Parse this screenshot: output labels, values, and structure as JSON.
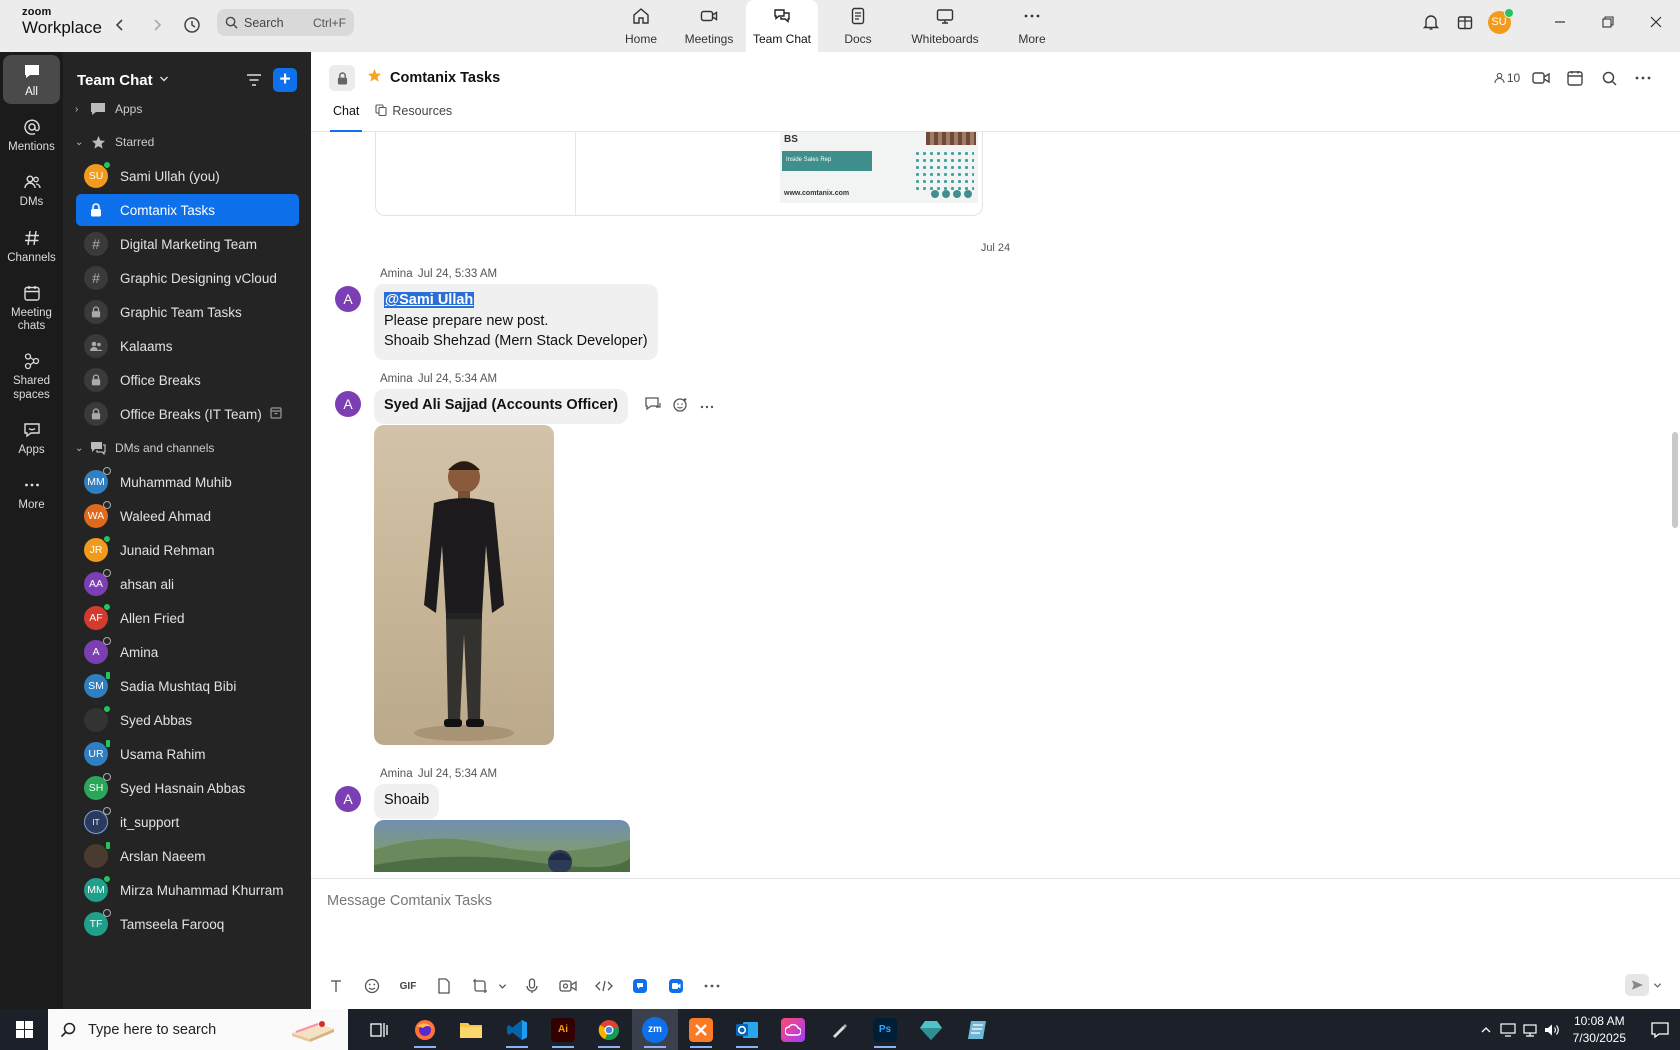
{
  "app": {
    "brand_top": "zoom",
    "brand_bottom": "Workplace"
  },
  "search": {
    "placeholder": "Search",
    "shortcut": "Ctrl+F"
  },
  "top_tabs": [
    {
      "label": "Home",
      "icon": "home-icon"
    },
    {
      "label": "Meetings",
      "icon": "video-icon"
    },
    {
      "label": "Team Chat",
      "icon": "chat-icon",
      "active": true
    },
    {
      "label": "Docs",
      "icon": "doc-icon"
    },
    {
      "label": "Whiteboards",
      "icon": "whiteboard-icon"
    },
    {
      "label": "More",
      "icon": "more-icon"
    }
  ],
  "profile": {
    "initials": "SU",
    "status_color": "#22c55e"
  },
  "rail": [
    {
      "label": "All",
      "icon": "chat-bubble-icon",
      "active": true
    },
    {
      "label": "Mentions",
      "icon": "at-icon"
    },
    {
      "label": "DMs",
      "icon": "people-icon"
    },
    {
      "label": "Channels",
      "icon": "hash-icon"
    },
    {
      "label": "Meeting chats",
      "icon": "calendar-icon"
    },
    {
      "label": "Shared spaces",
      "icon": "shared-icon"
    },
    {
      "label": "Apps",
      "icon": "apps-icon"
    },
    {
      "label": "More",
      "icon": "more-icon"
    }
  ],
  "sidebar": {
    "title": "Team Chat",
    "apps_label": "Apps",
    "starred_label": "Starred",
    "starred": [
      {
        "label": "Sami Ullah (you)",
        "kind": "avatar",
        "initials": "SU",
        "color": "#f29a1c",
        "status": "on"
      },
      {
        "label": "Comtanix Tasks",
        "kind": "lock",
        "active": true
      },
      {
        "label": "Digital Marketing Team",
        "kind": "hash"
      },
      {
        "label": "Graphic Designing vCloud",
        "kind": "hash"
      },
      {
        "label": "Graphic Team Tasks",
        "kind": "lock"
      },
      {
        "label": "Kalaams",
        "kind": "group"
      },
      {
        "label": "Office Breaks",
        "kind": "lock"
      },
      {
        "label": "Office Breaks (IT Team)",
        "kind": "lock",
        "trail": "archive-icon"
      }
    ],
    "dms_label": "DMs and channels",
    "dms": [
      {
        "label": "Muhammad Muhib",
        "initials": "MM",
        "color": "#2f7fc1",
        "status": "off"
      },
      {
        "label": "Waleed Ahmad",
        "initials": "WA",
        "color": "#e06a1c",
        "status": "off"
      },
      {
        "label": "Junaid Rehman",
        "initials": "JR",
        "color": "#f29a1c",
        "status": "on"
      },
      {
        "label": "ahsan ali",
        "initials": "AA",
        "color": "#7b3fb3",
        "status": "off"
      },
      {
        "label": "Allen Fried",
        "initials": "AF",
        "color": "#d23b2e",
        "status": "on"
      },
      {
        "label": "Amina",
        "initials": "A",
        "color": "#7b3fb3",
        "status": "off"
      },
      {
        "label": "Sadia Mushtaq Bibi",
        "initials": "SM",
        "color": "#2f7fc1",
        "status": "phone"
      },
      {
        "label": "Syed Abbas",
        "initials": "",
        "color": "#333333",
        "status": "on"
      },
      {
        "label": "Usama Rahim",
        "initials": "UR",
        "color": "#2f7fc1",
        "status": "phone"
      },
      {
        "label": "Syed Hasnain Abbas",
        "initials": "SH",
        "color": "#2aa65a",
        "status": "off"
      },
      {
        "label": "it_support",
        "initials": "IT",
        "color": "#2b3a5c",
        "status": "off"
      },
      {
        "label": "Arslan Naeem",
        "initials": "",
        "color": "#4a3a30",
        "status": "phone"
      },
      {
        "label": "Mirza Muhammad Khurram",
        "initials": "MM",
        "color": "#20a08a",
        "status": "on"
      },
      {
        "label": "Tamseela Farooq",
        "initials": "TF",
        "color": "#20a08a",
        "status": "off"
      }
    ]
  },
  "channel": {
    "name": "Comtanix Tasks",
    "member_count": "10",
    "tabs": [
      "Chat",
      "Resources"
    ]
  },
  "flyer": {
    "title": "BS",
    "band": "Inside Sales Rep",
    "url": "www.comtanix.com"
  },
  "date_separator": "Jul 24",
  "messages": [
    {
      "author": "Amina",
      "time": "Jul 24, 5:33 AM",
      "initial": "A",
      "mention": "@Sami Ullah",
      "lines": [
        "Please prepare new post.",
        "Shoaib Shehzad (Mern Stack Developer)"
      ]
    },
    {
      "author": "Amina",
      "time": "Jul 24, 5:34 AM",
      "initial": "A",
      "text": "Syed Ali Sajjad (Accounts Officer)"
    },
    {
      "author": "Amina",
      "time": "Jul 24, 5:34 AM",
      "initial": "A",
      "text": "Shoaib"
    }
  ],
  "composer": {
    "placeholder": "Message Comtanix Tasks",
    "gif_label": "GIF"
  },
  "taskbar": {
    "search_placeholder": "Type here to search",
    "zoom_app_label": "zm",
    "ai_label": "Ai",
    "ps_label": "Ps",
    "time": "10:08 AM",
    "date": "7/30/2025"
  }
}
